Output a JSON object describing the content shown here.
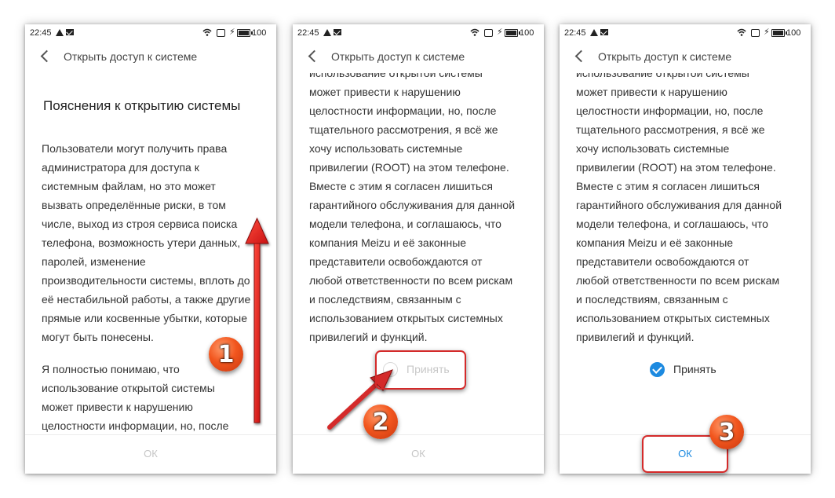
{
  "status": {
    "time": "22:45",
    "battery_level": "100"
  },
  "header": {
    "title": "Открыть доступ к системе"
  },
  "screen1": {
    "heading": "Пояснения к открытию системы",
    "para1": [
      "Пользователи могут получить права",
      "администратора для доступа к",
      "системным файлам, но это может",
      "вызвать определённые риски, в том",
      "числе, выход из строя сервиса поиска",
      "телефона, возможность утери данных,",
      "паролей, изменение",
      "производительности системы, вплоть до",
      "её нестабильной работы, а также другие",
      "прямые или косвенные убытки, которые",
      "могут быть понесены."
    ],
    "para2": [
      "Я полностью понимаю, что",
      "использование открытой системы",
      "может привести к нарушению",
      "целостности информации, но, после"
    ]
  },
  "agreement_text": [
    "использование открытой системы",
    "может привести к нарушению",
    "целостности информации, но, после",
    "тщательного рассмотрения, я всё же",
    "хочу использовать системные",
    "привилегии (ROOT) на этом телефоне.",
    "Вместе с этим я согласен лишиться",
    "гарантийного обслуживания для данной",
    "модели телефона, и соглашаюсь, что",
    "компания Meizu и её законные",
    "представители освобождаются от",
    "любой ответственности по всем рискам",
    "и последствиям, связанным с",
    "использованием открытых системных",
    "привилегий и функций."
  ],
  "accept_label": "Принять",
  "ok_label": "ОК",
  "screen2": {
    "accept_checked": false
  },
  "screen3": {
    "accept_checked": true
  },
  "steps": [
    "1",
    "2",
    "3"
  ],
  "colors": {
    "accent": "#1d8ae0",
    "highlight": "#d42a2a",
    "badge": "#f2561e",
    "disabled": "#c6c6c6"
  }
}
